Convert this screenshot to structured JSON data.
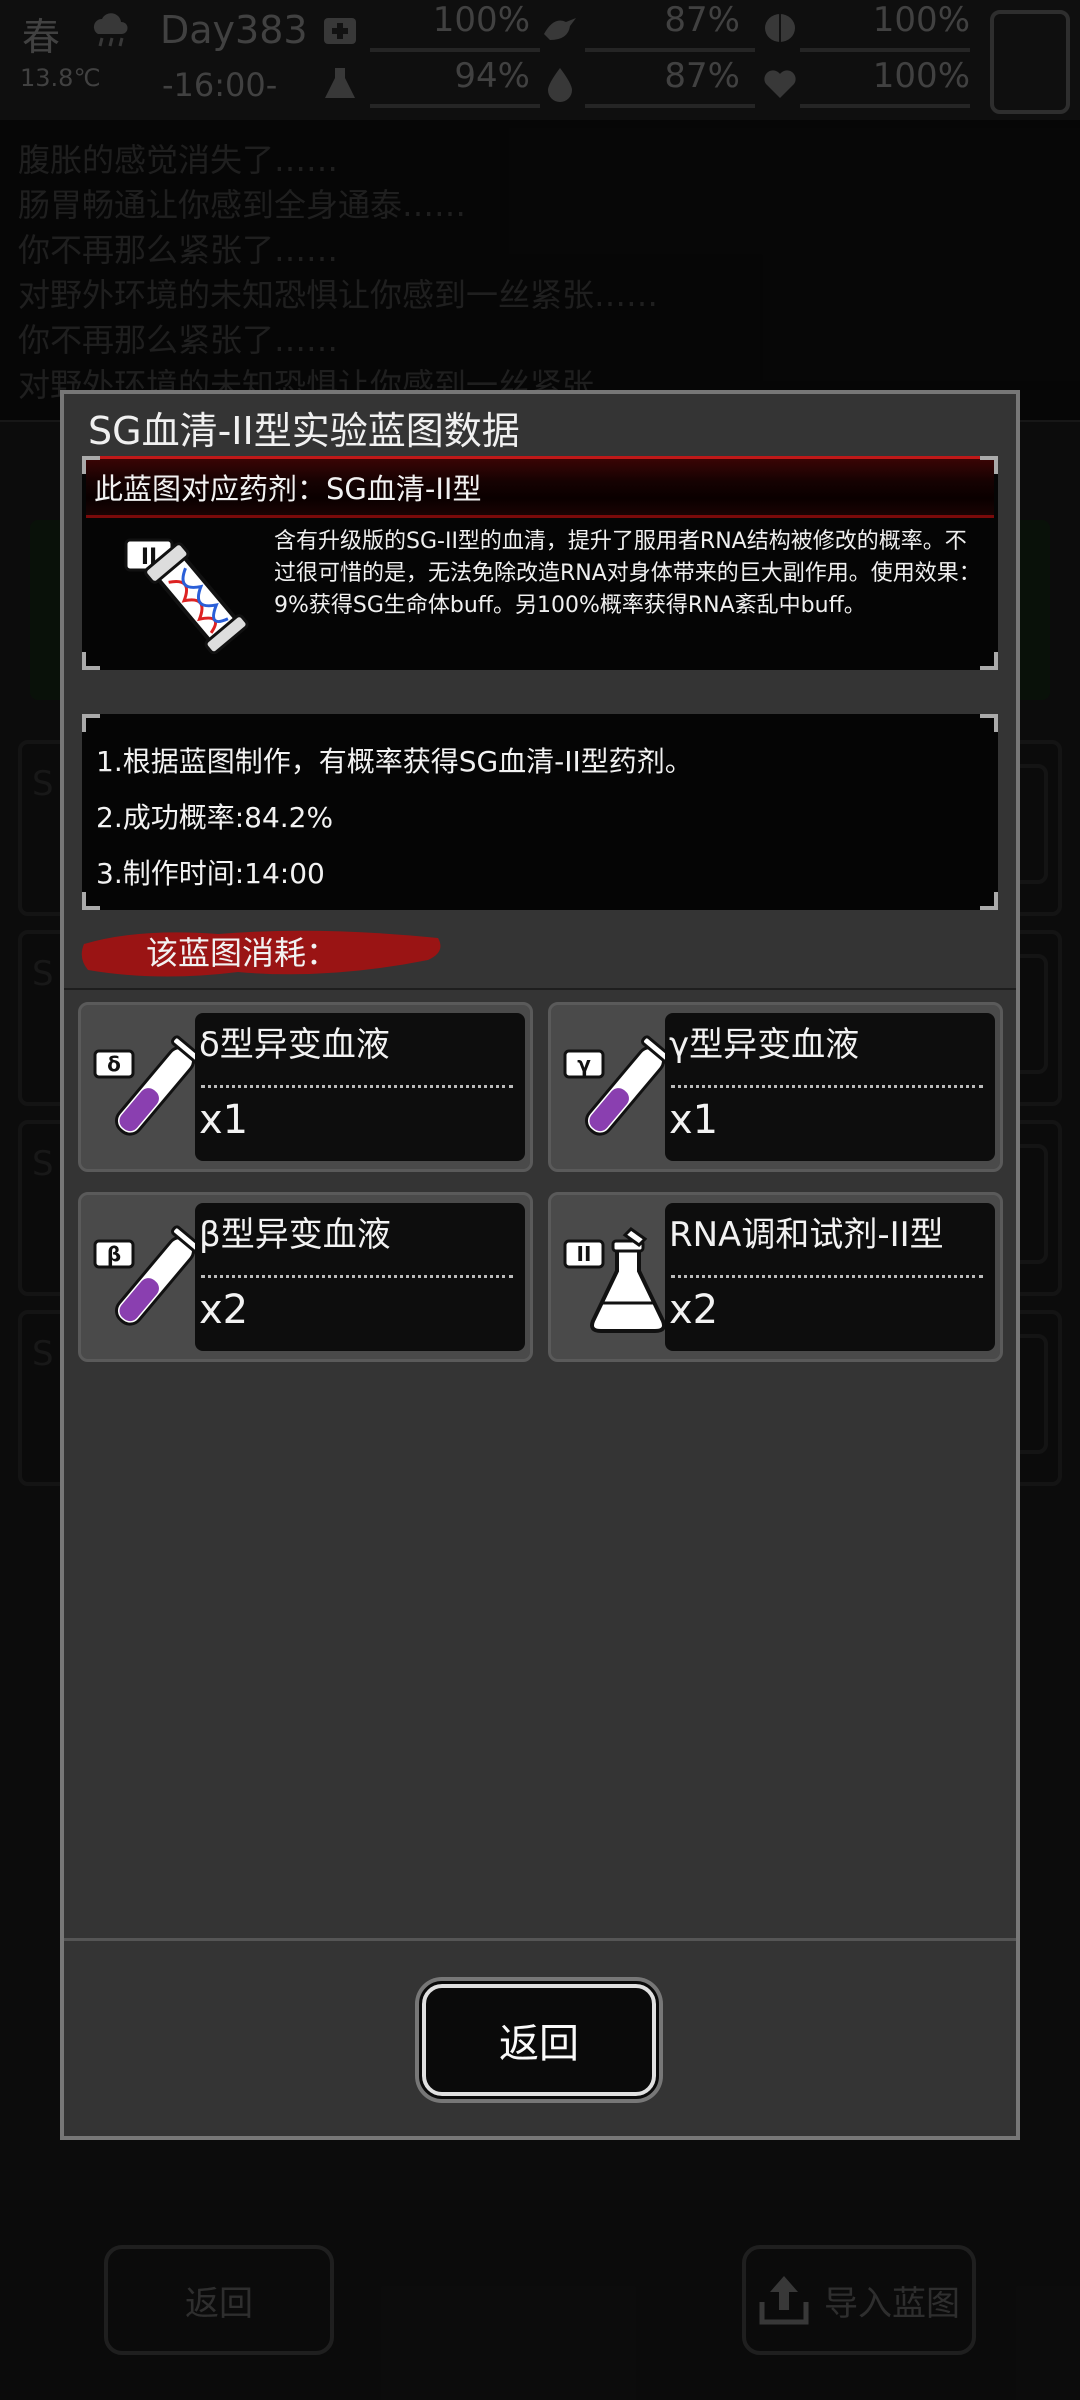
{
  "status": {
    "season": "春",
    "day": "Day383",
    "temperature": "13.8℃",
    "time": "-16:00-",
    "stats": [
      "100%",
      "87%",
      "100%",
      "94%",
      "87%",
      "100%"
    ]
  },
  "log_lines": [
    "腹胀的感觉消失了……",
    "肠胃畅通让你感到全身通泰……",
    "你不再那么紧张了……",
    "对野外环境的未知恐惧让你感到一丝紧张……",
    "你不再那么紧张了……",
    "对野外环境的未知恐惧让你感到一丝紧张……"
  ],
  "background_buttons": {
    "back": "返回",
    "import": "导入蓝图"
  },
  "modal": {
    "title": "SG血清-II型实验蓝图数据",
    "info": {
      "header": "此蓝图对应药剂：SG血清-II型",
      "description": "含有升级版的SG-II型的血清，提升了服用者RNA结构被修改的概率。不过很可惜的是，无法免除改造RNA对身体带来的巨大副作用。使用效果：9%获得SG生命体buff。另100%概率获得RNA紊乱中buff。",
      "icon_badge": "II"
    },
    "steps": [
      "1.根据蓝图制作，有概率获得SG血清-II型药剂。",
      "2.成功概率:84.2%",
      "3.制作时间:14:00"
    ],
    "consume_label": "该蓝图消耗：",
    "items": [
      {
        "name": "δ型异变血液",
        "qty": "x1",
        "badge": "δ",
        "icon": "test-tube-icon",
        "liquid": "#8a3fb0"
      },
      {
        "name": "γ型异变血液",
        "qty": "x1",
        "badge": "γ",
        "icon": "test-tube-icon",
        "liquid": "#8a3fb0"
      },
      {
        "name": "β型异变血液",
        "qty": "x2",
        "badge": "β",
        "icon": "test-tube-icon",
        "liquid": "#8a3fb0"
      },
      {
        "name": "RNA调和试剂-II型",
        "qty": "x2",
        "badge": "II",
        "icon": "flask-icon",
        "liquid": "#ffffff"
      }
    ],
    "back_label": "返回"
  }
}
